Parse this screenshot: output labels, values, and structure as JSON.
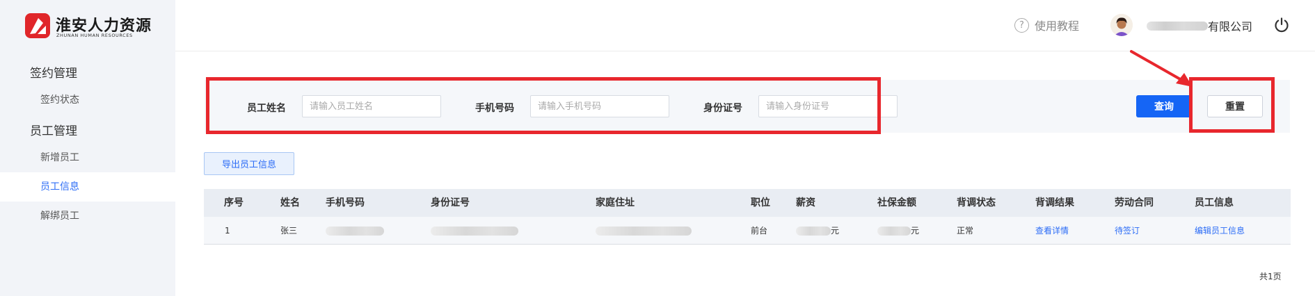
{
  "logo": {
    "name": "淮安人力资源",
    "subtitle": "ZHUNAN HUMAN RESOURCES"
  },
  "sidebar": {
    "groups": [
      {
        "title": "签约管理",
        "items": [
          {
            "label": "签约状态",
            "active": false
          }
        ]
      },
      {
        "title": "员工管理",
        "items": [
          {
            "label": "新增员工",
            "active": false
          },
          {
            "label": "员工信息",
            "active": true
          },
          {
            "label": "解绑员工",
            "active": false
          }
        ]
      }
    ]
  },
  "header": {
    "tutorial_label": "使用教程",
    "company_suffix": "有限公司",
    "help_icon": "question-circle-icon",
    "power_icon": "power-icon"
  },
  "filters": {
    "name_label": "员工姓名",
    "name_placeholder": "请输入员工姓名",
    "name_value": "",
    "phone_label": "手机号码",
    "phone_placeholder": "请输入手机号码",
    "phone_value": "",
    "id_label": "身份证号",
    "id_placeholder": "请输入身份证号",
    "id_value": ""
  },
  "buttons": {
    "query": "查询",
    "reset": "重置",
    "export": "导出员工信息"
  },
  "table": {
    "headers": [
      "序号",
      "姓名",
      "手机号码",
      "身份证号",
      "家庭住址",
      "职位",
      "薪资",
      "社保金额",
      "背调状态",
      "背调结果",
      "劳动合同",
      "员工信息"
    ],
    "rows": [
      {
        "index": "1",
        "name": "张三",
        "position": "前台",
        "salary_suffix": "元",
        "insurance_suffix": "元",
        "bg_status": "正常",
        "bg_result": "查看详情",
        "contract": "待签订",
        "edit": "编辑员工信息"
      }
    ]
  },
  "pagination": {
    "total_pages": "共1页"
  },
  "colors": {
    "accent": "#1565f5",
    "link": "#2d6df6",
    "highlight": "#e8272d",
    "brand": "#e0262a"
  }
}
